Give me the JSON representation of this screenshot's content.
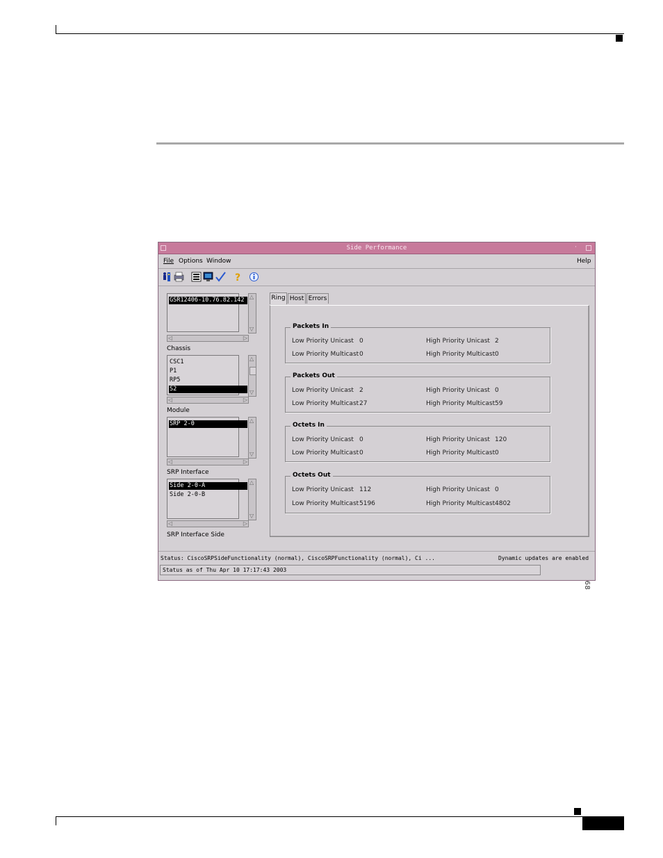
{
  "figure_id": "80668",
  "window": {
    "title": "Side Performance"
  },
  "menu": {
    "file": "File",
    "options": "Options",
    "window": "Window",
    "help": "Help"
  },
  "toolbar": {
    "icons": [
      "user-icon",
      "printer-icon",
      "list-icon",
      "monitor-icon",
      "check-icon",
      "question-icon",
      "info-icon"
    ]
  },
  "chassis": {
    "label": "Chassis",
    "items": [
      "GSR12406-10.76.82.142"
    ],
    "selected": "GSR12406-10.76.82.142"
  },
  "module": {
    "label": "Module",
    "items": [
      "CSC1",
      "P1",
      "RP5",
      "S2"
    ],
    "selected": "S2"
  },
  "srp_interface": {
    "label": "SRP Interface",
    "items": [
      "SRP 2-0"
    ],
    "selected": "SRP 2-0"
  },
  "srp_interface_side": {
    "label": "SRP Interface Side",
    "items": [
      "Side 2-0-A",
      "Side 2-0-B"
    ],
    "selected": "Side 2-0-A"
  },
  "tabs": [
    "Ring",
    "Host",
    "Errors"
  ],
  "active_tab": "Ring",
  "groups": [
    {
      "title": "Packets In",
      "rows": [
        {
          "l_label": "Low Priority Unicast",
          "l_value": "0",
          "r_label": "High Priority Unicast",
          "r_value": "2"
        },
        {
          "l_label": "Low Priority Multicast",
          "l_value": "0",
          "r_label": "High Priority Multicast",
          "r_value": "0"
        }
      ]
    },
    {
      "title": "Packets Out",
      "rows": [
        {
          "l_label": "Low Priority Unicast",
          "l_value": "2",
          "r_label": "High Priority Unicast",
          "r_value": "0"
        },
        {
          "l_label": "Low Priority Multicast",
          "l_value": "27",
          "r_label": "High Priority Multicast",
          "r_value": "59"
        }
      ]
    },
    {
      "title": "Octets In",
      "rows": [
        {
          "l_label": "Low Priority Unicast",
          "l_value": "0",
          "r_label": "High Priority Unicast",
          "r_value": "120"
        },
        {
          "l_label": "Low Priority Multicast",
          "l_value": "0",
          "r_label": "High Priority Multicast",
          "r_value": "0"
        }
      ]
    },
    {
      "title": "Octets Out",
      "rows": [
        {
          "l_label": "Low Priority Unicast",
          "l_value": "112",
          "r_label": "High Priority Unicast",
          "r_value": "0"
        },
        {
          "l_label": "Low Priority Multicast",
          "l_value": "5196",
          "r_label": "High Priority Multicast",
          "r_value": "4802"
        }
      ]
    }
  ],
  "status": {
    "text": "Status: CiscoSRPSideFunctionality (normal), CiscoSRPFunctionality (normal), Ci ...",
    "updates": "Dynamic updates are enabled",
    "as_of": "Status as of Thu Apr 10 17:17:43 2003"
  },
  "colors": {
    "titlebar": "#c77a9b",
    "window_bg": "#d4d0d4",
    "selection": "#000000"
  }
}
